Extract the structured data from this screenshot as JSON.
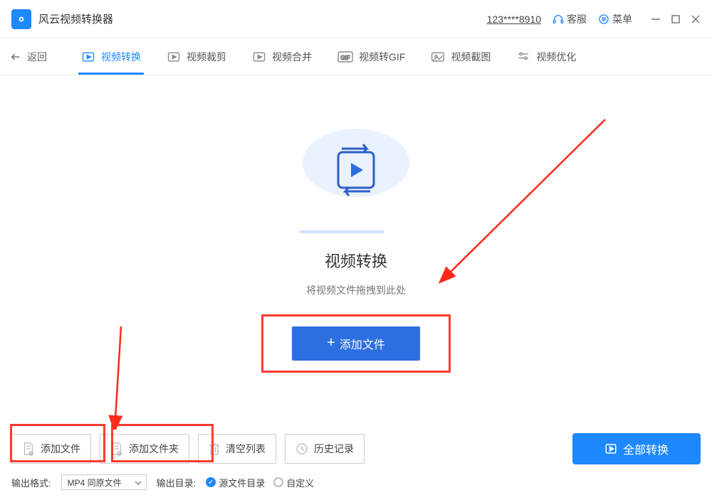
{
  "titlebar": {
    "app_name": "风云视频转换器",
    "user_id": "123****8910",
    "support_label": "客服",
    "menu_label": "菜单"
  },
  "nav": {
    "back_label": "返回",
    "tabs": [
      {
        "label": "视频转换"
      },
      {
        "label": "视频裁剪"
      },
      {
        "label": "视频合并"
      },
      {
        "label": "视频转GIF"
      },
      {
        "label": "视频截图"
      },
      {
        "label": "视频优化"
      }
    ]
  },
  "hero": {
    "title": "视频转换",
    "subtitle": "将视频文件拖拽到此处",
    "add_button_label": "添加文件"
  },
  "bottom": {
    "buttons": {
      "add_file": "添加文件",
      "add_folder": "添加文件夹",
      "clear_list": "清空列表",
      "history": "历史记录"
    },
    "convert_label": "全部转换",
    "output_format_label": "输出格式:",
    "output_format_value": "MP4 同原文件",
    "output_dir_label": "输出目录:",
    "dir_option_source": "源文件目录",
    "dir_option_custom": "自定义"
  }
}
